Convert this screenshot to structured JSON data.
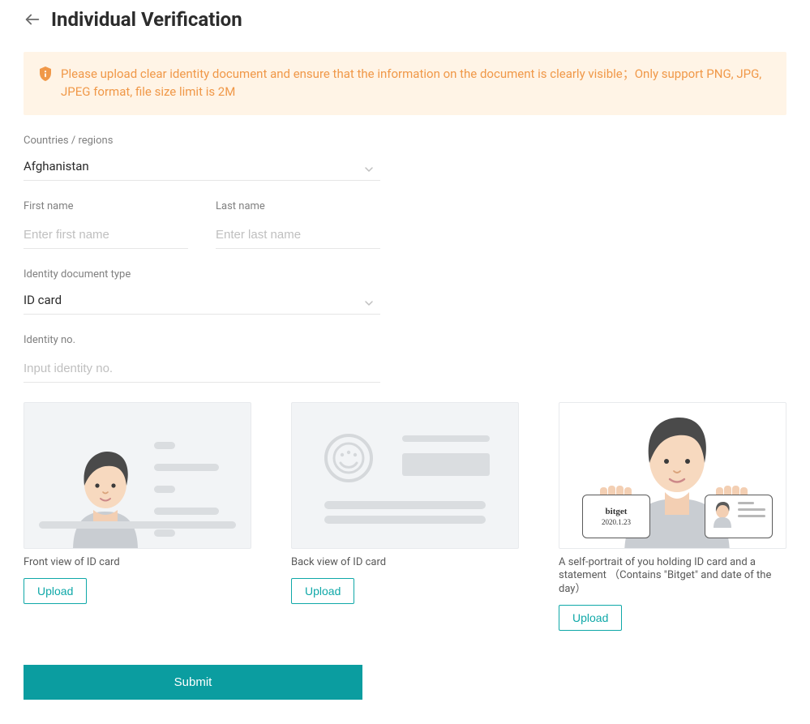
{
  "page": {
    "title": "Individual Verification"
  },
  "notice": {
    "text": "Please upload clear identity document and ensure that the information on the document is clearly visible；Only support PNG, JPG, JPEG format, file size limit is 2M"
  },
  "form": {
    "country": {
      "label": "Countries / regions",
      "value": "Afghanistan"
    },
    "first_name": {
      "label": "First name",
      "placeholder": "Enter first name",
      "value": ""
    },
    "last_name": {
      "label": "Last name",
      "placeholder": "Enter last name",
      "value": ""
    },
    "doc_type": {
      "label": "Identity document type",
      "value": "ID card"
    },
    "identity_no": {
      "label": "Identity no.",
      "placeholder": "Input identity no.",
      "value": ""
    }
  },
  "uploads": {
    "front": {
      "caption": "Front view of ID card",
      "button": "Upload"
    },
    "back": {
      "caption": "Back view of ID card",
      "button": "Upload"
    },
    "self": {
      "caption": "A self-portrait of you holding ID card and a statement （Contains \"Bitget\" and date of the day）",
      "button": "Upload",
      "demo_brand": "bitget",
      "demo_date": "2020.1.23"
    }
  },
  "actions": {
    "submit": "Submit"
  },
  "colors": {
    "accent": "#0fa8a8",
    "notice_bg": "#fff4e6",
    "notice_text": "#f09848"
  }
}
